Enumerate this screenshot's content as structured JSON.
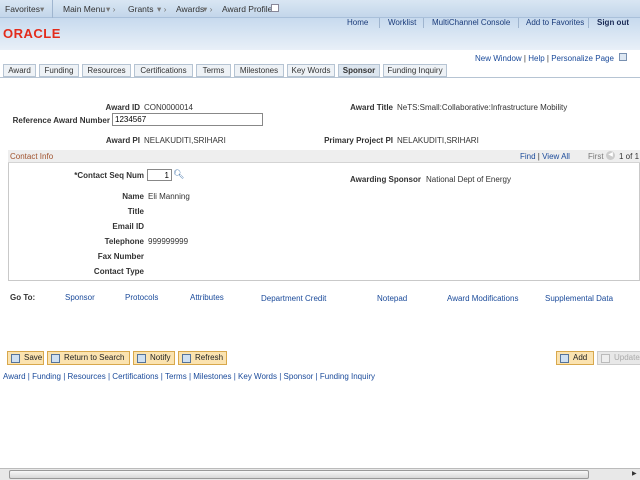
{
  "topnav": {
    "favorites": "Favorites",
    "main_menu": "Main Menu",
    "grants": "Grants",
    "awards": "Awards",
    "award_profile": "Award Profile"
  },
  "header": {
    "logo": "ORACLE",
    "links": [
      "Home",
      "Worklist",
      "MultiChannel Console",
      "Add to Favorites",
      "Sign out"
    ]
  },
  "page_links": {
    "new_window": "New Window",
    "help": "Help",
    "personalize": "Personalize Page"
  },
  "tabs": [
    "Award",
    "Funding",
    "Resources",
    "Certifications",
    "Terms",
    "Milestones",
    "Key Words",
    "Sponsor",
    "Funding Inquiry"
  ],
  "active_tab": "Sponsor",
  "form": {
    "award_id_label": "Award ID",
    "award_id": "CON0000014",
    "award_title_label": "Award Title",
    "award_title": "NeTS:Small:Collaborative:Infrastructure Mobility",
    "ref_label": "Reference Award Number",
    "ref_value": "1234567",
    "award_pi_label": "Award PI",
    "award_pi": "NELAKUDITI,SRIHARI",
    "primary_pi_label": "Primary Project PI",
    "primary_pi": "NELAKUDITI,SRIHARI"
  },
  "contact": {
    "title": "Contact Info",
    "find": "Find",
    "view_all": "View All",
    "first": "First",
    "count": "1 of 1",
    "seq_label": "*Contact Seq Num",
    "seq_value": "1",
    "sponsor_label": "Awarding Sponsor",
    "sponsor": "National Dept of Energy",
    "name_label": "Name",
    "name": "Eli Manning",
    "title_label": "Title",
    "email_label": "Email ID",
    "phone_label": "Telephone",
    "phone": "999999999",
    "fax_label": "Fax Number",
    "type_label": "Contact Type"
  },
  "goto": {
    "label": "Go To:",
    "links": [
      "Sponsor",
      "Protocols",
      "Attributes",
      "Department Credit",
      "Notepad",
      "Award Modifications",
      "Supplemental Data"
    ]
  },
  "buttons": {
    "save": "Save",
    "return": "Return to Search",
    "notify": "Notify",
    "refresh": "Refresh",
    "add": "Add",
    "update": "Update/Display"
  },
  "footer_links": [
    "Award",
    "Funding",
    "Resources",
    "Certifications",
    "Terms",
    "Milestones",
    "Key Words",
    "Sponsor",
    "Funding Inquiry"
  ]
}
